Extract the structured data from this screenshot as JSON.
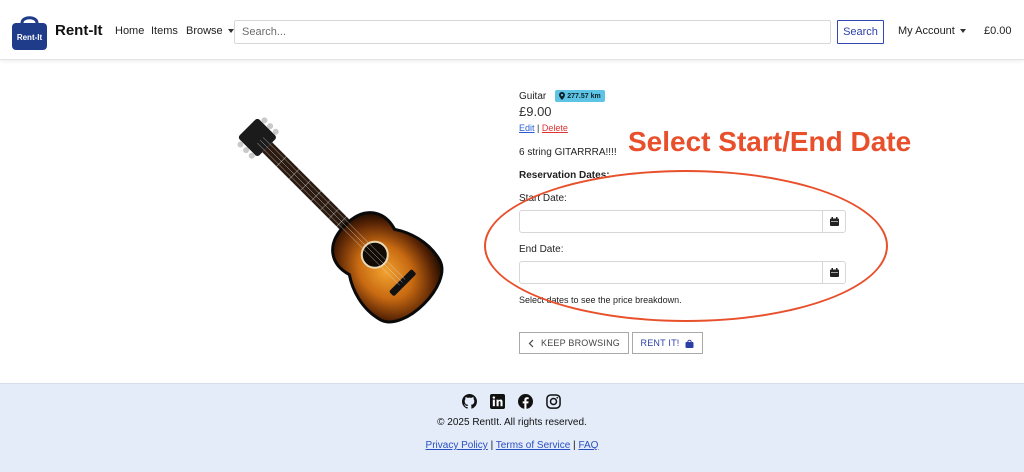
{
  "navbar": {
    "logo_text": "Rent-It",
    "brand": "Rent-It",
    "home": "Home",
    "items": "Items",
    "browse": "Browse",
    "search_placeholder": "Search...",
    "search_button": "Search",
    "account": "My Account",
    "cart_total": "£0.00"
  },
  "item": {
    "name": "Guitar",
    "distance": "277.57 km",
    "price": "£9.00",
    "edit": "Edit",
    "separator": "|",
    "delete": "Delete",
    "description": "6 string GITARRRA!!!!"
  },
  "reservation": {
    "heading": "Reservation Dates:",
    "start_label": "Start Date:",
    "end_label": "End Date:",
    "breakdown_hint": "Select dates to see the price breakdown."
  },
  "actions": {
    "keep_browsing": "KEEP BROWSING",
    "rent_it": "RENT IT!"
  },
  "annotation": {
    "text": "Select Start/End Date",
    "color": "#e8502c"
  },
  "footer": {
    "social_icons": [
      "github-icon",
      "linkedin-icon",
      "facebook-icon",
      "instagram-icon"
    ],
    "copyright": "© 2025 RentIt. All rights reserved.",
    "privacy": "Privacy Policy",
    "terms": "Terms of Service",
    "faq": "FAQ",
    "sep": "|"
  },
  "colors": {
    "accent": "#2c3fa6",
    "badge": "#5dc4e6",
    "footer_bg": "#e4ecfa"
  }
}
